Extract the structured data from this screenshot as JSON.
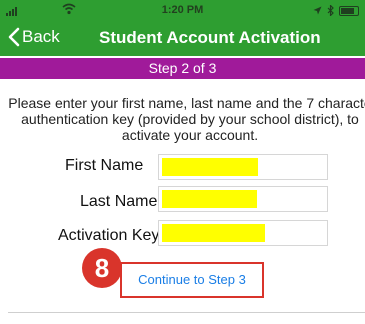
{
  "status_bar": {
    "time": "1:20 PM",
    "background": "#2e9e31"
  },
  "nav": {
    "back_label": "Back",
    "title": "Student Account Activation"
  },
  "step_banner": {
    "text": "Step 2 of 3",
    "background": "#a01a9a"
  },
  "instructions": {
    "line1": "Please enter your first name, last name and the 7 characte",
    "line2": "authentication key (provided by your school district), to",
    "line3": "activate your account."
  },
  "form": {
    "first_name_label": "First Name",
    "last_name_label": "Last Name",
    "activation_key_label": "Activation Key",
    "first_name_value": "",
    "last_name_value": "",
    "activation_key_value": ""
  },
  "continue_button": {
    "label": "Continue to Step 3"
  },
  "annotation": {
    "step_badge": "8",
    "highlight_color": "#d9342b"
  }
}
